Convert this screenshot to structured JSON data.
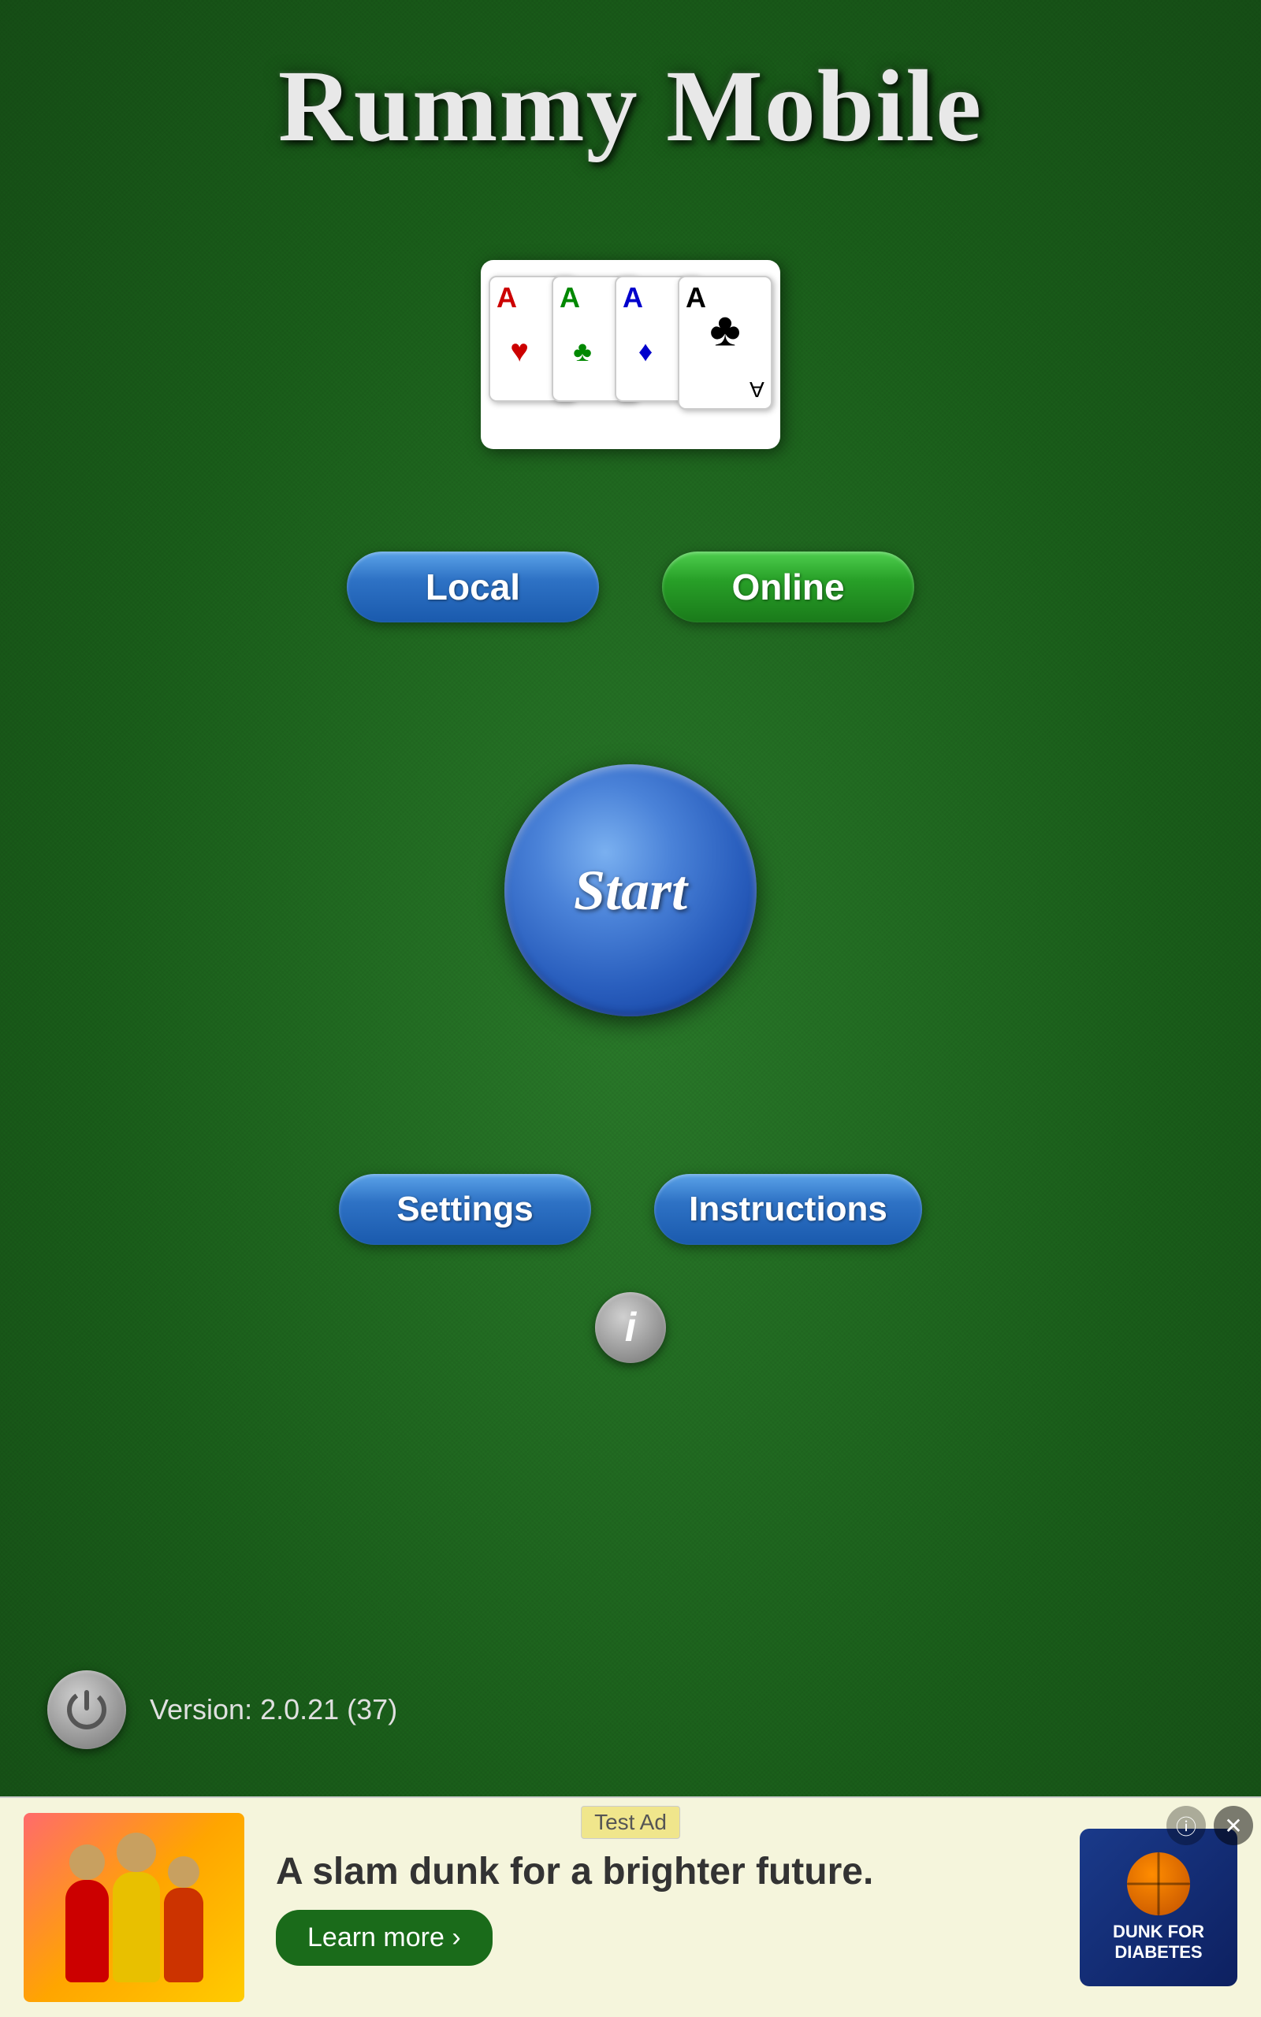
{
  "app": {
    "title": "Rummy Mobile",
    "version_label": "Version: 2.0.21 (37)"
  },
  "cards": {
    "card1": {
      "rank": "A",
      "suit": "♥",
      "suit_small": "♥",
      "color": "red"
    },
    "card2": {
      "rank": "A",
      "suit": "♣",
      "suit_small": "♦",
      "color": "green"
    },
    "card3": {
      "rank": "A",
      "suit": "♦",
      "suit_small": "♦",
      "color": "blue"
    },
    "card4": {
      "rank": "A",
      "suit": "♣",
      "suit_small": "♣",
      "color": "black"
    }
  },
  "buttons": {
    "local_label": "Local",
    "online_label": "Online",
    "start_label": "Start",
    "settings_label": "Settings",
    "instructions_label": "Instructions",
    "info_label": "i",
    "learn_more_label": "Learn more ›"
  },
  "ad": {
    "test_label": "Test Ad",
    "text": "A slam dunk for a brighter future.",
    "logo_line1": "DUNK FOR",
    "logo_line2": "DIABETES"
  }
}
